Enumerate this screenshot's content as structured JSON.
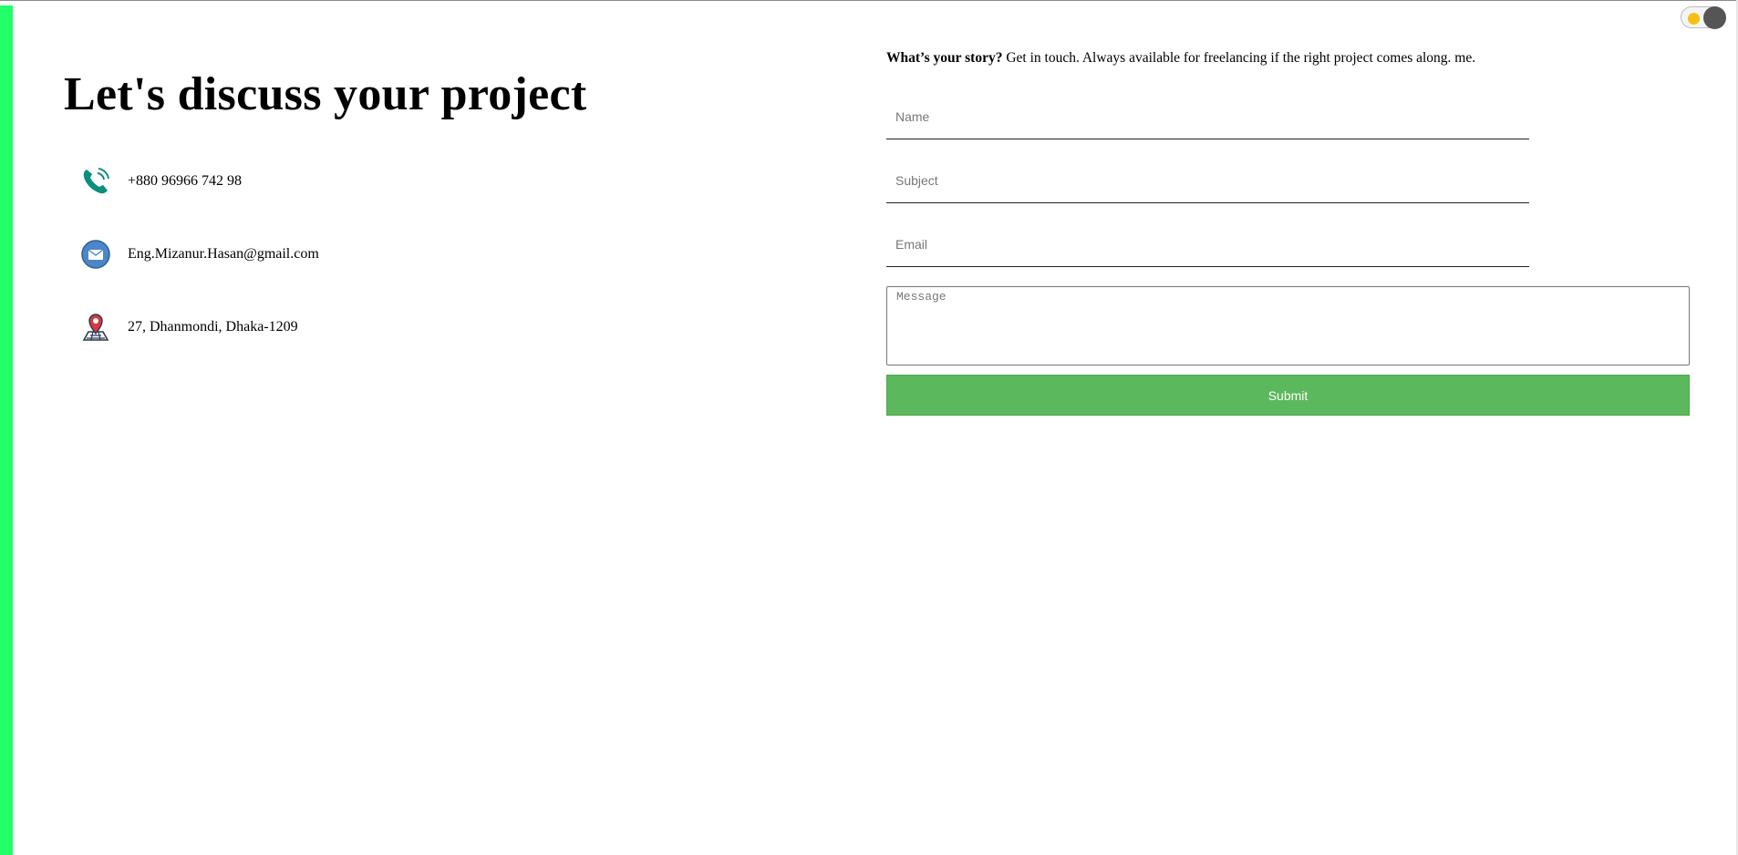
{
  "theme_toggle": {
    "state": "light",
    "accent": "#f6c012",
    "knob_color": "#555555"
  },
  "page_accent": "#22ff6a",
  "heading": {
    "title": "Let's discuss your project"
  },
  "contacts": [
    {
      "icon": "phone-icon",
      "text": "+880 96966 742 98"
    },
    {
      "icon": "mail-icon",
      "text": "Eng.Mizanur.Hasan@gmail.com"
    },
    {
      "icon": "map-pin-icon",
      "text": "27, Dhanmondi, Dhaka-1209"
    }
  ],
  "intro": {
    "lead": "What’s your story?",
    "body": " Get in touch. Always available for freelancing if the right project comes along. me."
  },
  "form": {
    "name_placeholder": "Name",
    "subject_placeholder": "Subject",
    "email_placeholder": "Email",
    "message_placeholder": "Message",
    "submit_label": "Submit",
    "submit_color": "#5cb85c"
  }
}
